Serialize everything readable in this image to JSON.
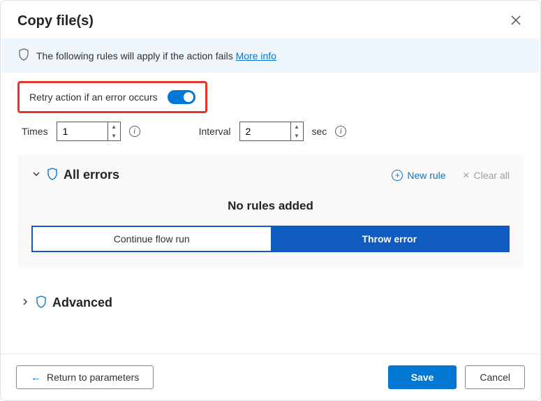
{
  "header": {
    "title": "Copy file(s)"
  },
  "banner": {
    "text": "The following rules will apply if the action fails",
    "link": "More info"
  },
  "retry": {
    "label": "Retry action if an error occurs",
    "on": true
  },
  "times": {
    "label": "Times",
    "value": "1"
  },
  "interval": {
    "label": "Interval",
    "value": "2",
    "unit": "sec"
  },
  "errors": {
    "title": "All errors",
    "new_rule": "New rule",
    "clear_all": "Clear all",
    "empty": "No rules added",
    "continue": "Continue flow run",
    "throw": "Throw error"
  },
  "advanced": {
    "label": "Advanced"
  },
  "footer": {
    "return": "Return to parameters",
    "save": "Save",
    "cancel": "Cancel"
  }
}
